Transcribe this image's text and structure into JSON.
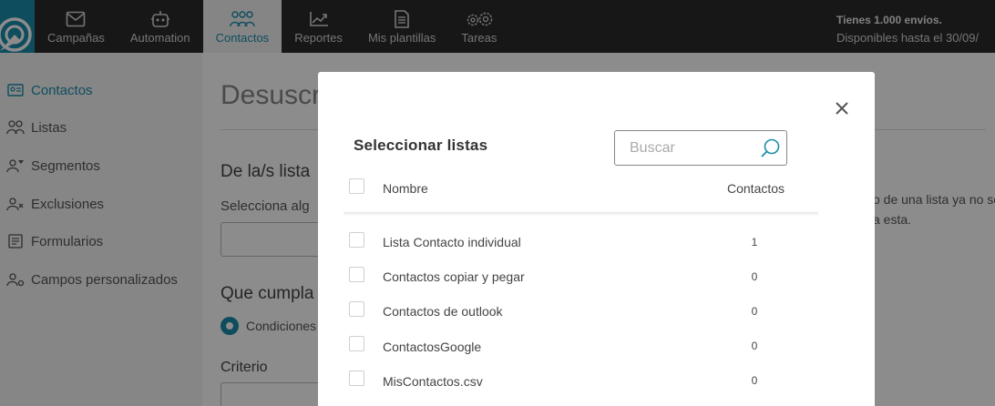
{
  "topbar": {
    "nav": [
      {
        "label": "Campañas",
        "icon": "envelope-icon"
      },
      {
        "label": "Automation",
        "icon": "robot-icon"
      },
      {
        "label": "Contactos",
        "icon": "people-icon"
      },
      {
        "label": "Reportes",
        "icon": "chart-icon"
      },
      {
        "label": "Mis plantillas",
        "icon": "document-icon"
      },
      {
        "label": "Tareas",
        "icon": "gears-icon"
      }
    ],
    "active_nav": "Contactos",
    "shipments_line1": "Tienes 1.000 envíos.",
    "shipments_line2": "Disponibles hasta el 30/09/"
  },
  "sidebar": {
    "items": [
      {
        "label": "Contactos",
        "icon": "contact-card-icon"
      },
      {
        "label": "Listas",
        "icon": "users-icon"
      },
      {
        "label": "Segmentos",
        "icon": "user-filter-icon"
      },
      {
        "label": "Exclusiones",
        "icon": "user-x-icon"
      },
      {
        "label": "Formularios",
        "icon": "form-icon"
      },
      {
        "label": "Campos personalizados",
        "icon": "user-settings-icon"
      }
    ]
  },
  "main": {
    "title": "Desuscr",
    "section1": "De la/s lista",
    "select_hint": "Selecciona alg",
    "section2": "Que cumpla",
    "radio_label": "Condiciones",
    "criteria_label": "Criterio",
    "right_note_line1": "o de una lista ya no se",
    "right_note_line2": "a esta."
  },
  "modal": {
    "title": "Seleccionar listas",
    "search_placeholder": "Buscar",
    "col_name": "Nombre",
    "col_contacts": "Contactos",
    "rows": [
      {
        "name": "Lista Contacto individual",
        "count": "1"
      },
      {
        "name": "Contactos copiar y pegar",
        "count": "0"
      },
      {
        "name": "Contactos de outlook",
        "count": "0"
      },
      {
        "name": "ContactosGoogle",
        "count": "0"
      },
      {
        "name": "MisContactos.csv",
        "count": "0"
      }
    ]
  },
  "colors": {
    "accent": "#1a8cab",
    "topbar_bg": "#2b2b2b",
    "overlay": "rgba(0,0,0,0.45)"
  }
}
